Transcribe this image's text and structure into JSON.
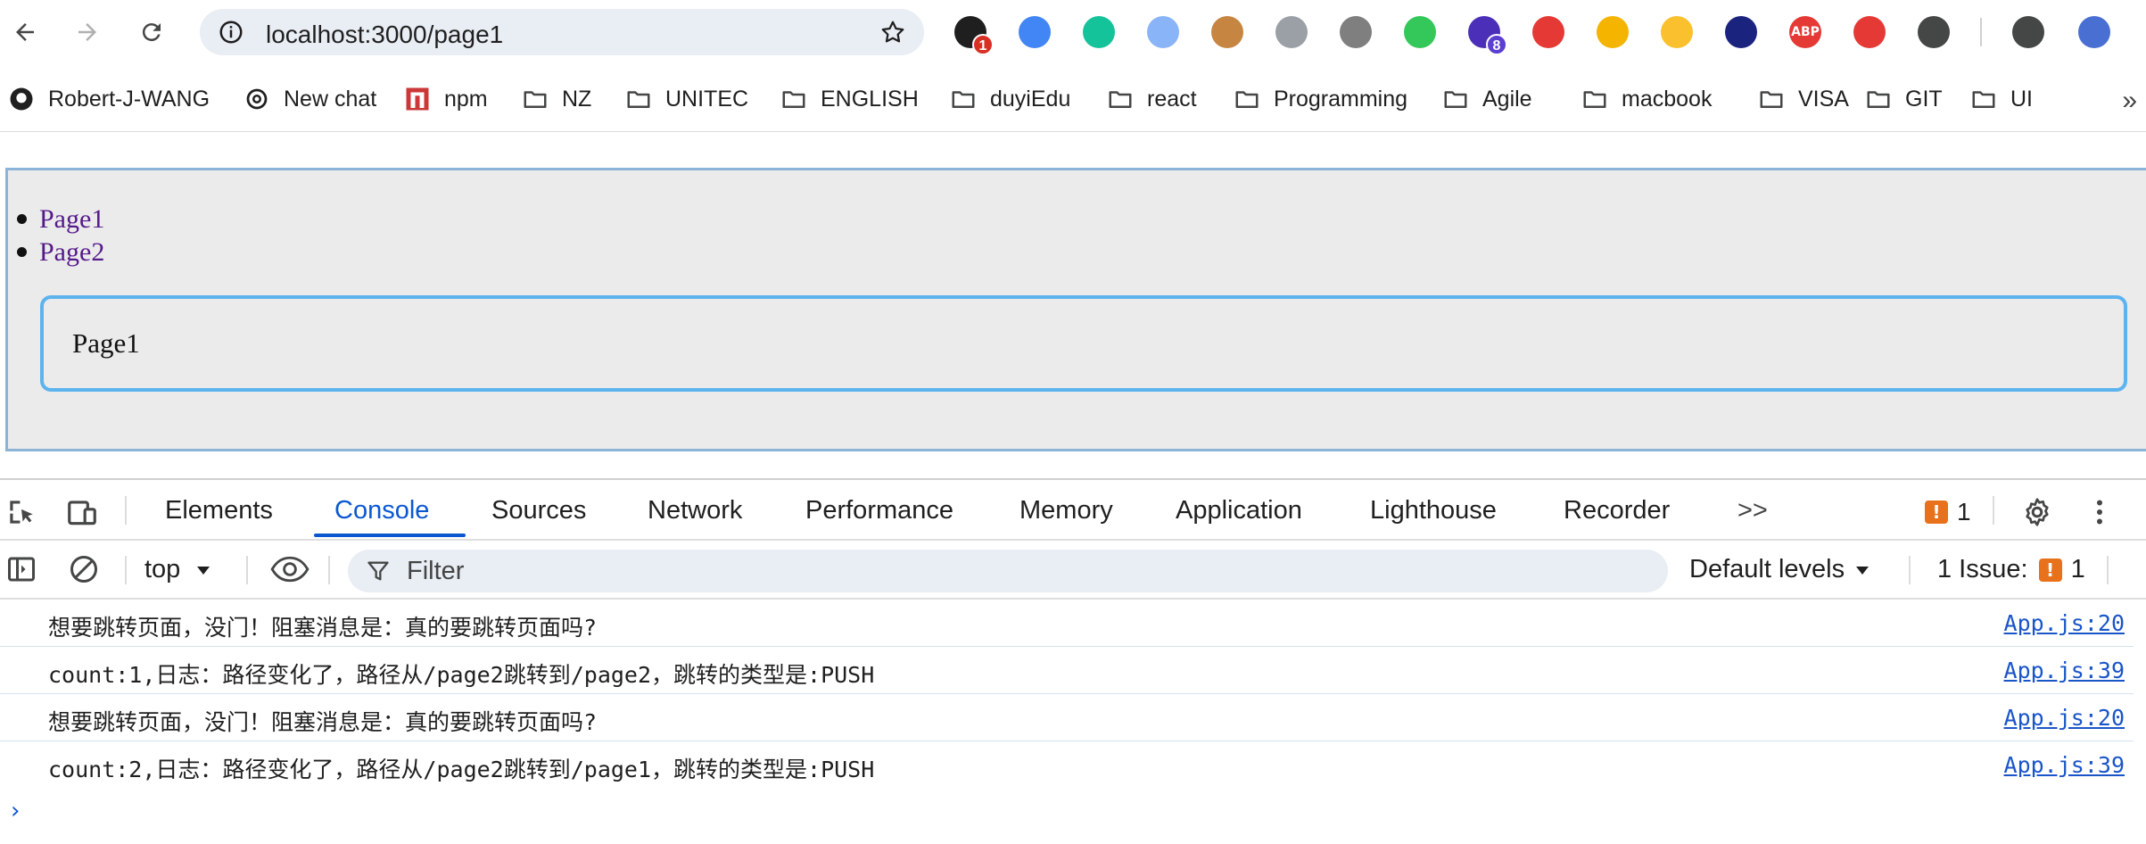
{
  "browser": {
    "url": "localhost:3000/page1",
    "extensions": [
      {
        "name": "chat-ext-icon",
        "badge": "1",
        "color": "#1f1f1f",
        "badge_color": "#d93025"
      },
      {
        "name": "translate-icon",
        "badge": "",
        "color": "#4285f4"
      },
      {
        "name": "grammarly-icon",
        "badge": "",
        "color": "#15c39a"
      },
      {
        "name": "search-ext-icon",
        "badge": "",
        "color": "#8ab4f8"
      },
      {
        "name": "cookie-icon",
        "badge": "",
        "color": "#c68642"
      },
      {
        "name": "camera-icon",
        "badge": "",
        "color": "#9aa0a6"
      },
      {
        "name": "bug-icon",
        "badge": "",
        "color": "#7f7f7f"
      },
      {
        "name": "n-ext-icon",
        "badge": "",
        "color": "#34c759"
      },
      {
        "name": "stack-ext-icon",
        "badge": "8",
        "color": "#4b2fb8",
        "badge_color": "#5b3fd1"
      },
      {
        "name": "sync-ext-icon",
        "badge": "",
        "color": "#e53935"
      },
      {
        "name": "color-picker-icon",
        "badge": "",
        "color": "#f4b400"
      },
      {
        "name": "mouse-ext-icon",
        "badge": "",
        "color": "#fbc02d"
      },
      {
        "name": "cube-ext-icon",
        "badge": "",
        "color": "#1a237e"
      },
      {
        "name": "adblock-icon",
        "badge": "",
        "color": "#e53935",
        "label": "ABP"
      },
      {
        "name": "block-icon",
        "badge": "",
        "color": "#e53935"
      },
      {
        "name": "puzzle-icon",
        "badge": "",
        "color": "#444746"
      },
      {
        "name": "media-icon",
        "badge": "",
        "color": "#444746"
      },
      {
        "name": "profile-avatar-icon",
        "badge": "",
        "color": "#4a6fd3"
      }
    ]
  },
  "bookmarks": [
    {
      "label": "Robert-J-WANG",
      "icon": "github-icon"
    },
    {
      "label": "New chat",
      "icon": "openai-icon"
    },
    {
      "label": "npm",
      "icon": "npm-icon"
    },
    {
      "label": "NZ",
      "icon": "folder-icon"
    },
    {
      "label": "UNITEC",
      "icon": "folder-icon"
    },
    {
      "label": "ENGLISH",
      "icon": "folder-icon"
    },
    {
      "label": "duyiEdu",
      "icon": "folder-icon"
    },
    {
      "label": "react",
      "icon": "folder-icon"
    },
    {
      "label": "Programming",
      "icon": "folder-icon"
    },
    {
      "label": "Agile",
      "icon": "folder-icon"
    },
    {
      "label": "macbook",
      "icon": "folder-icon"
    },
    {
      "label": "VISA",
      "icon": "folder-icon"
    },
    {
      "label": "GIT",
      "icon": "folder-icon"
    },
    {
      "label": "UI",
      "icon": "folder-icon"
    }
  ],
  "page": {
    "links": [
      "Page1",
      "Page2"
    ],
    "content": "Page1"
  },
  "devtools": {
    "tabs": [
      "Elements",
      "Console",
      "Sources",
      "Network",
      "Performance",
      "Memory",
      "Application",
      "Lighthouse",
      "Recorder"
    ],
    "active_tab": "Console",
    "more_tabs": ">>",
    "issues_badge": "1",
    "context": "top",
    "filter_placeholder": "Filter",
    "levels": "Default levels",
    "issues_label": "1 Issue:",
    "issues_count": "1",
    "logs": [
      {
        "message": "想要跳转页面，没门！阻塞消息是：真的要跳转页面吗?",
        "source": "App.js:20"
      },
      {
        "message": "count:1,日志：路径变化了，路径从/page2跳转到/page2，跳转的类型是:PUSH",
        "source": "App.js:39"
      },
      {
        "message": "想要跳转页面，没门！阻塞消息是：真的要跳转页面吗?",
        "source": "App.js:20"
      },
      {
        "message": "count:2,日志：路径变化了，路径从/page2跳转到/page1，跳转的类型是:PUSH",
        "source": "App.js:39"
      }
    ],
    "prompt": "›"
  },
  "colors": {
    "accent": "#0b57d0",
    "link_visited": "#551a8b",
    "page_box_border": "#5cb3ee",
    "warning": "#e8711c"
  }
}
